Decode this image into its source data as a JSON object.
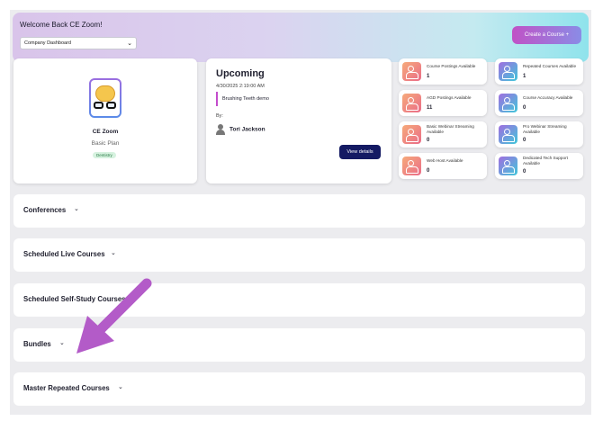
{
  "header": {
    "welcome": "Welcome Back CE Zoom!",
    "dashboard_select": "Company Dashboard",
    "create_button": "Create a Course +"
  },
  "profile": {
    "name": "CE Zoom",
    "plan": "Basic Plan",
    "badge": "Dentistry"
  },
  "upcoming": {
    "title": "Upcoming",
    "datetime": "4/30/2025 2:19:00 AM",
    "event": "Brushing Teeth demo",
    "by_label": "By:",
    "host": "Tori Jackson",
    "view_button": "View details"
  },
  "stats": [
    {
      "label": "Course Postings Available",
      "value": "1"
    },
    {
      "label": "Repeated Courses Available",
      "value": "1"
    },
    {
      "label": "AGD Postings Available",
      "value": "11"
    },
    {
      "label": "Course Accuracy Available",
      "value": "0"
    },
    {
      "label": "Basic Webinar Streaming Available",
      "value": "0"
    },
    {
      "label": "Pro Webinar Streaming Available",
      "value": "0"
    },
    {
      "label": "Web Host Available",
      "value": "0"
    },
    {
      "label": "Dedicated Tech Support Available",
      "value": "0"
    }
  ],
  "sections": [
    {
      "title": "Conferences"
    },
    {
      "title": "Scheduled Live Courses"
    },
    {
      "title": "Scheduled Self-Study Courses"
    },
    {
      "title": "Bundles"
    },
    {
      "title": "Master Repeated Courses"
    }
  ],
  "icons": {
    "chevron": "chevron-down-icon",
    "stat_icon": "users-icon",
    "annotation": "arrow-annotation"
  },
  "colors": {
    "accent": "#141a63",
    "create_gradient_start": "#c052c6",
    "create_gradient_end": "#8a8ce6",
    "annotation_arrow": "#b35bc8"
  }
}
